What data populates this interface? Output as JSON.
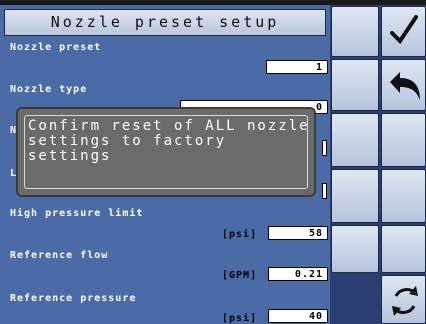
{
  "title": "Nozzle preset setup",
  "rows": {
    "nozzle_preset": {
      "label": "Nozzle preset",
      "value": "1"
    },
    "nozzle_type": {
      "label": "Nozzle type",
      "value": "0"
    },
    "row3": {
      "label_visible": "N"
    },
    "row4": {
      "label_visible": "L"
    },
    "high_pressure_limit": {
      "label": "High pressure limit",
      "unit": "[psi]",
      "value": "58"
    },
    "reference_flow": {
      "label": "Reference flow",
      "unit": "[GPM]",
      "value": "0.21"
    },
    "reference_pressure": {
      "label": "Reference pressure",
      "unit": "[psi]",
      "value": "40"
    }
  },
  "dialog": {
    "message": "Confirm reset of ALL nozzle\nsettings to factory\nsettings"
  },
  "buttons": {
    "accept": {
      "icon": "checkmark-icon"
    },
    "back": {
      "icon": "back-arrow-icon"
    },
    "reset": {
      "icon": "refresh-icon"
    }
  },
  "colors": {
    "panel": "#4a6ba6",
    "side": "#2b3f73",
    "dialog": "#6b6b6b"
  }
}
